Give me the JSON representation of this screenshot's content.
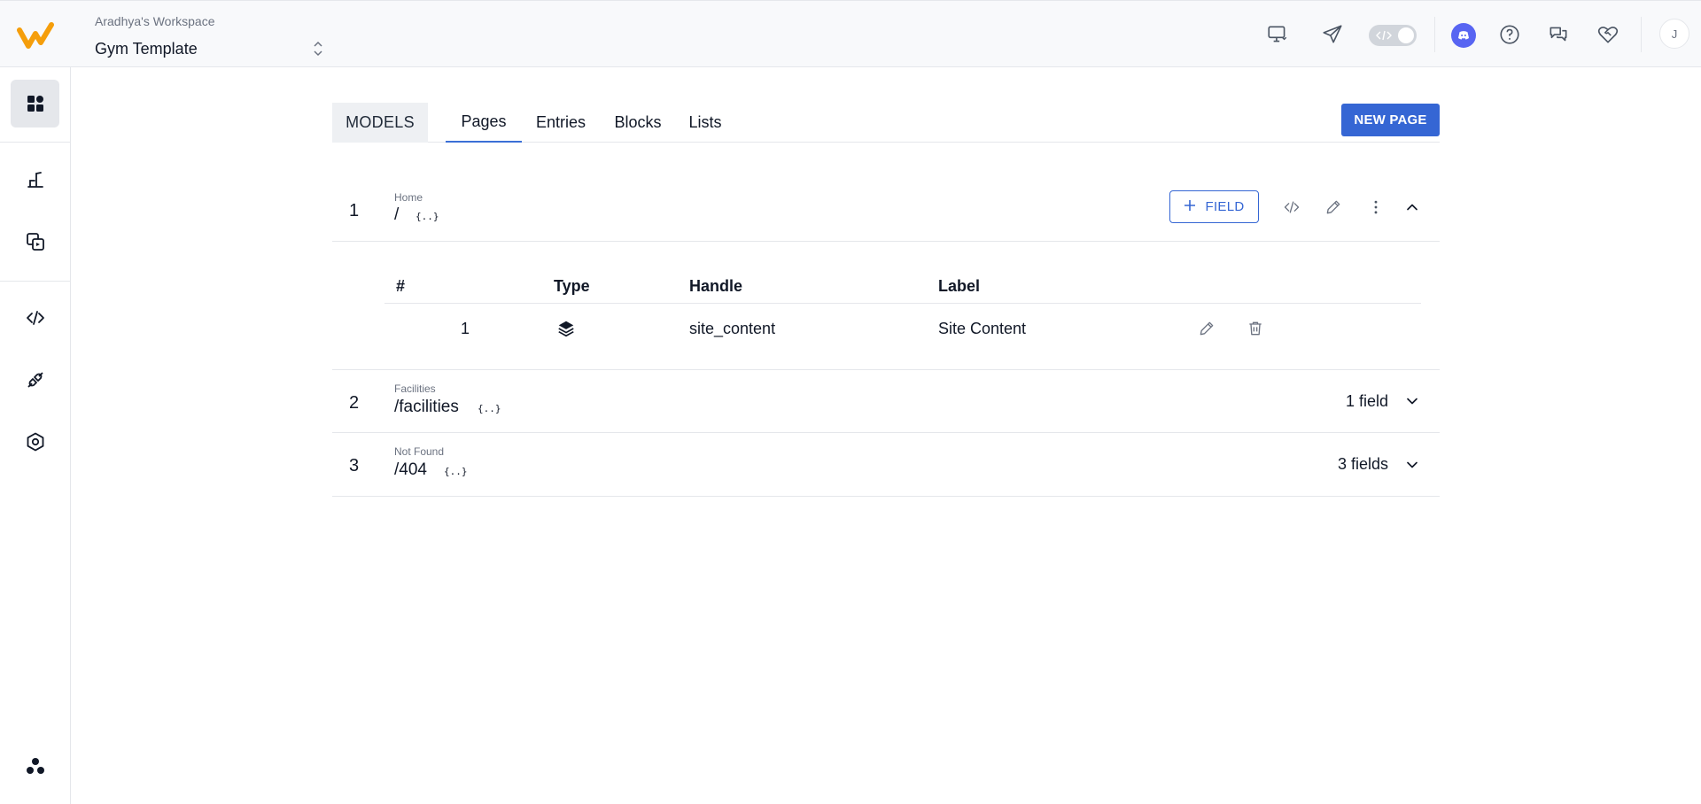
{
  "workspace": {
    "name": "Aradhya's Workspace",
    "project": "Gym Template"
  },
  "header": {
    "avatar_initial": "J",
    "icons": [
      "preview-icon",
      "send-icon",
      "dev-mode-toggle",
      "discord-icon",
      "help-icon",
      "chat-icon",
      "heart-handshake-icon"
    ]
  },
  "sidebar": {
    "items": [
      "dashboard-icon",
      "content-icon",
      "media-icon",
      "code-icon",
      "integration-icon",
      "settings-icon",
      "organization-icon"
    ]
  },
  "tabs": {
    "models_label": "MODELS",
    "items": [
      {
        "label": "Pages",
        "active": true
      },
      {
        "label": "Entries",
        "active": false
      },
      {
        "label": "Blocks",
        "active": false
      },
      {
        "label": "Lists",
        "active": false
      }
    ]
  },
  "new_page_label": "NEW PAGE",
  "pages": [
    {
      "num": "1",
      "name": "Home",
      "path": "/",
      "braces": "{..}",
      "expanded": true,
      "field_button": "FIELD",
      "table": {
        "headers": {
          "num": "#",
          "type": "Type",
          "handle": "Handle",
          "label": "Label"
        },
        "rows": [
          {
            "num": "1",
            "type_icon": "layers-icon",
            "handle": "site_content",
            "label": "Site Content"
          }
        ]
      }
    },
    {
      "num": "2",
      "name": "Facilities",
      "path": "/facilities",
      "braces": "{..}",
      "fields": "1 field"
    },
    {
      "num": "3",
      "name": "Not Found",
      "path": "/404",
      "braces": "{..}",
      "fields": "3 fields"
    }
  ],
  "colors": {
    "primary": "#3566d4",
    "logo": "#f59e0b",
    "discord": "#5865f2"
  }
}
